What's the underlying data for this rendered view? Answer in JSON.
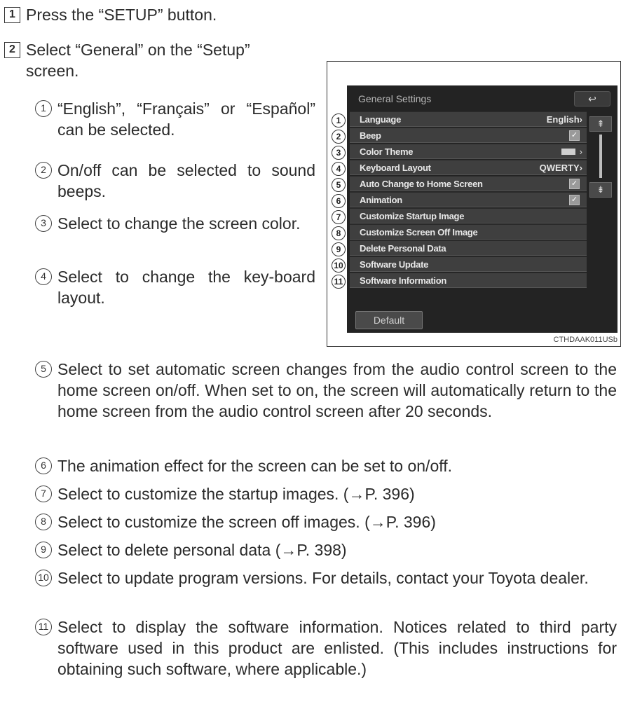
{
  "steps": [
    {
      "num": "1",
      "text": "Press the “SETUP” button."
    },
    {
      "num": "2",
      "text_line1": "Select “General” on the “Setup”",
      "text_line2": "screen."
    }
  ],
  "items_narrow": [
    {
      "num": "1",
      "text": "“English”, “Français” or “Español” can be selected."
    },
    {
      "num": "2",
      "text": "On/off can be selected to sound beeps."
    },
    {
      "num": "3",
      "text": "Select to change the screen color."
    },
    {
      "num": "4",
      "text": "Select to change the key-board layout."
    }
  ],
  "items_wide": [
    {
      "num": "5",
      "text": "Select to set automatic screen changes from the audio control screen to the home screen on/off. When set to on, the screen will automatically return to the home screen from the audio control screen after 20 seconds."
    },
    {
      "num": "6",
      "text": "The animation effect for the screen can be set to on/off."
    },
    {
      "num": "7",
      "text": "Select to customize the startup images. (→P. 396)"
    },
    {
      "num": "8",
      "text": "Select to customize the screen off images. (→P. 396)"
    },
    {
      "num": "9",
      "text": "Select to delete personal data (→P. 398)"
    },
    {
      "num": "10",
      "text": "Select to update program versions. For details, contact your Toyota dealer."
    },
    {
      "num": "11",
      "text": "Select to display the software information. Notices related to third party software used in this product are enlisted. (This includes instructions for obtaining such software, where applicable.)"
    }
  ],
  "figure": {
    "screen_title": "General Settings",
    "back_icon": "↩",
    "rows": [
      {
        "num": "1",
        "label": "Language",
        "value": "English›"
      },
      {
        "num": "2",
        "label": "Beep",
        "checked": true
      },
      {
        "num": "3",
        "label": "Color Theme",
        "value": "›"
      },
      {
        "num": "4",
        "label": "Keyboard Layout",
        "value": "QWERTY›"
      },
      {
        "num": "5",
        "label": "Auto Change to Home Screen",
        "checked": true
      },
      {
        "num": "6",
        "label": "Animation",
        "checked": true
      },
      {
        "num": "7",
        "label": "Customize Startup Image"
      },
      {
        "num": "8",
        "label": "Customize Screen Off Image"
      },
      {
        "num": "9",
        "label": "Delete Personal Data"
      },
      {
        "num": "10",
        "label": "Software Update"
      },
      {
        "num": "11",
        "label": "Software Information"
      }
    ],
    "scroll_up_icon": "⇞",
    "scroll_down_icon": "⇟",
    "default_label": "Default",
    "check_glyph": "✓",
    "code": "CTHDAAK011USb"
  }
}
